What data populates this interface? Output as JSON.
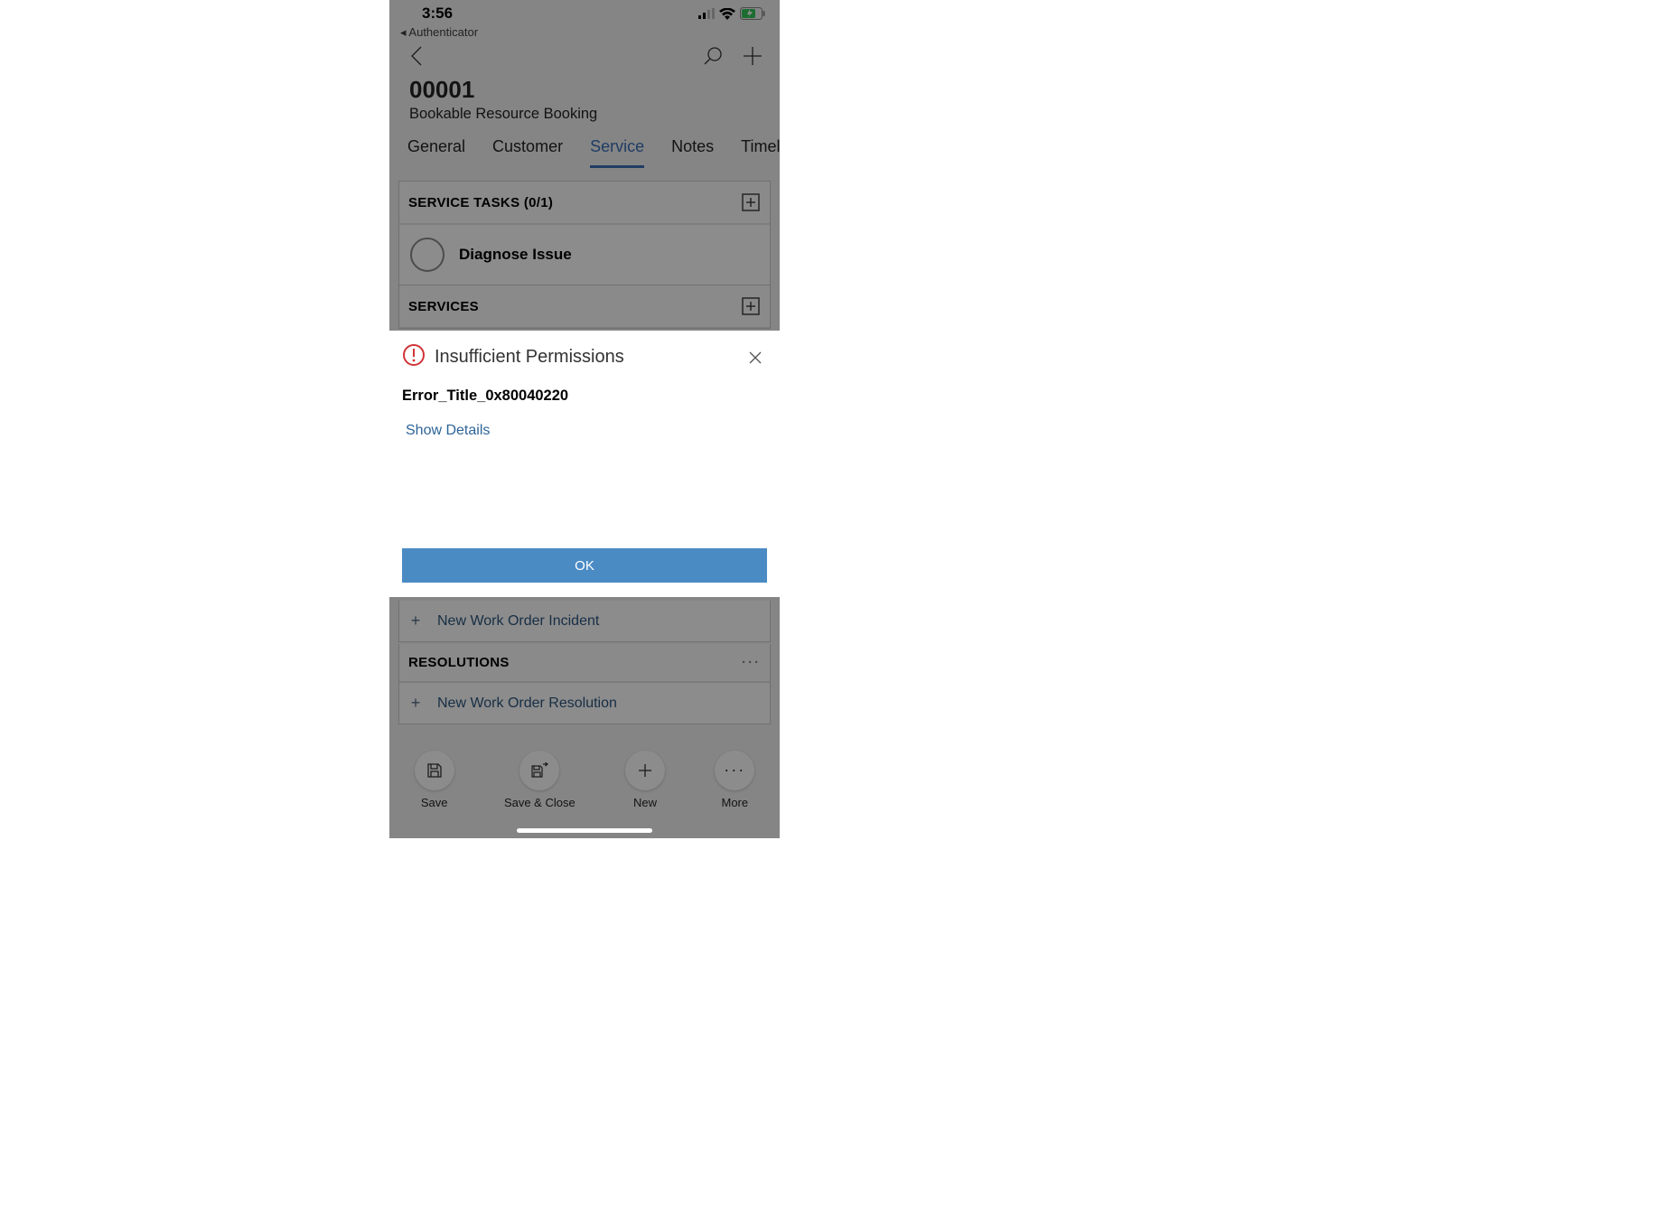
{
  "status": {
    "time": "3:56",
    "back_app": "◂ Authenticator"
  },
  "header": {
    "title": "00001",
    "subtitle": "Bookable Resource Booking"
  },
  "tabs": [
    "General",
    "Customer",
    "Service",
    "Notes",
    "Timeline"
  ],
  "active_tab_index": 2,
  "sections": {
    "service_tasks": {
      "label": "SERVICE TASKS (0/1)",
      "items": [
        "Diagnose Issue"
      ]
    },
    "services": {
      "label": "SERVICES"
    },
    "incident": {
      "add_label": "New Work Order Incident"
    },
    "resolutions": {
      "label": "RESOLUTIONS",
      "add_label": "New Work Order Resolution"
    }
  },
  "dialog": {
    "title": "Insufficient Permissions",
    "error_title": "Error_Title_0x80040220",
    "show_details": "Show Details",
    "ok": "OK"
  },
  "toolbar": {
    "save": "Save",
    "save_close": "Save & Close",
    "new": "New",
    "more": "More"
  }
}
